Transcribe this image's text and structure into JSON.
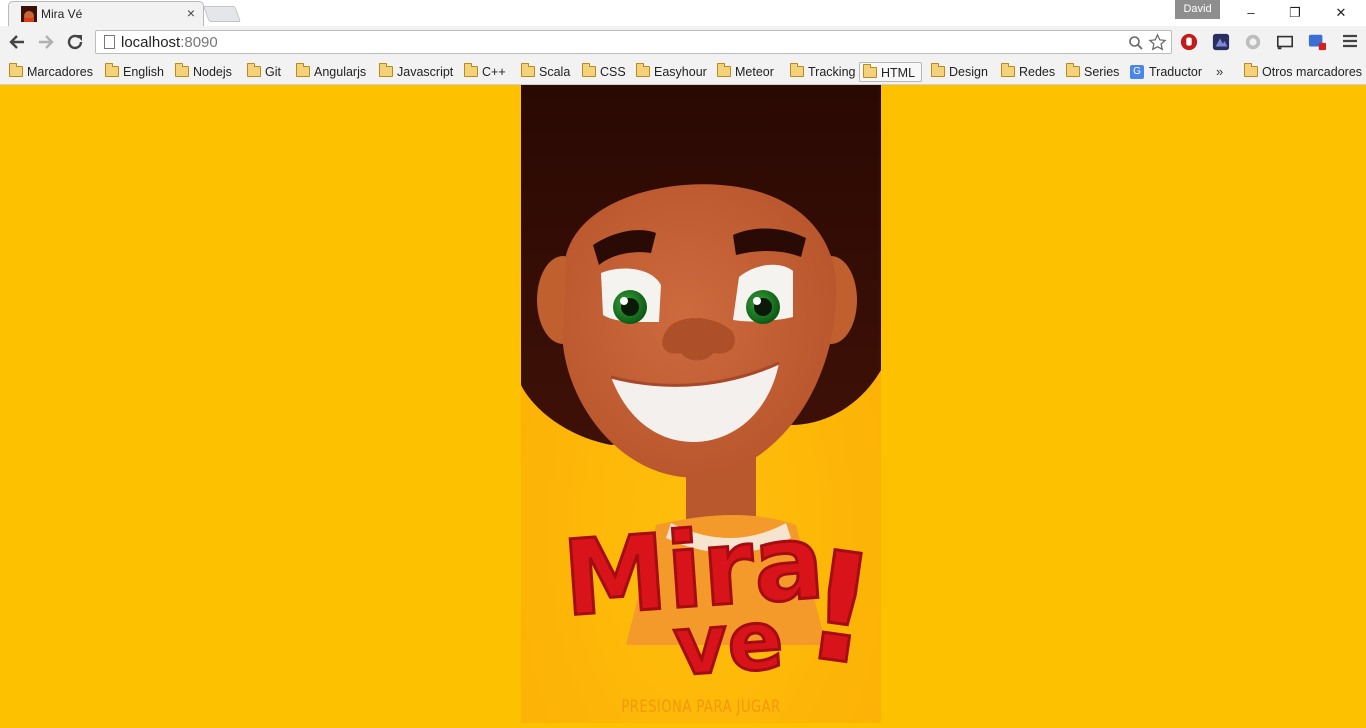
{
  "window": {
    "tab_title": "Mira Vé",
    "profile_name": "David",
    "close_tab_glyph": "×",
    "minimize_glyph": "–",
    "restore_glyph": "❐",
    "close_glyph": "✕"
  },
  "toolbar": {
    "url_host": "localhost",
    "url_port": ":8090"
  },
  "bookmarks": {
    "items": [
      {
        "label": "Marcadores",
        "icon": "folder-icon"
      },
      {
        "label": "English",
        "icon": "folder-icon"
      },
      {
        "label": "Nodejs",
        "icon": "folder-icon"
      },
      {
        "label": "Git",
        "icon": "folder-icon"
      },
      {
        "label": "Angularjs",
        "icon": "folder-icon"
      },
      {
        "label": "Javascript",
        "icon": "folder-icon"
      },
      {
        "label": "C++",
        "icon": "folder-icon"
      },
      {
        "label": "Scala",
        "icon": "folder-icon"
      },
      {
        "label": "CSS",
        "icon": "folder-icon"
      },
      {
        "label": "Easyhour",
        "icon": "folder-icon"
      },
      {
        "label": "Meteor",
        "icon": "folder-icon"
      },
      {
        "label": "Tracking",
        "icon": "folder-icon"
      },
      {
        "label": "HTML",
        "icon": "folder-icon"
      },
      {
        "label": "Design",
        "icon": "folder-icon"
      },
      {
        "label": "Redes",
        "icon": "folder-icon"
      },
      {
        "label": "Series",
        "icon": "folder-icon"
      },
      {
        "label": "Traductor",
        "icon": "translate-icon"
      }
    ],
    "more_glyph": "»",
    "other_label": "Otros marcadores"
  },
  "game": {
    "logo_line1": "Mira",
    "logo_line2": "ve",
    "logo_exclaim": "!",
    "play_prompt": "PRESIONA PARA JUGAR"
  },
  "colors": {
    "page_bg": "#fec100",
    "logo_red": "#d8141a",
    "hair": "#2e0a04",
    "skin": "#c8643a"
  }
}
